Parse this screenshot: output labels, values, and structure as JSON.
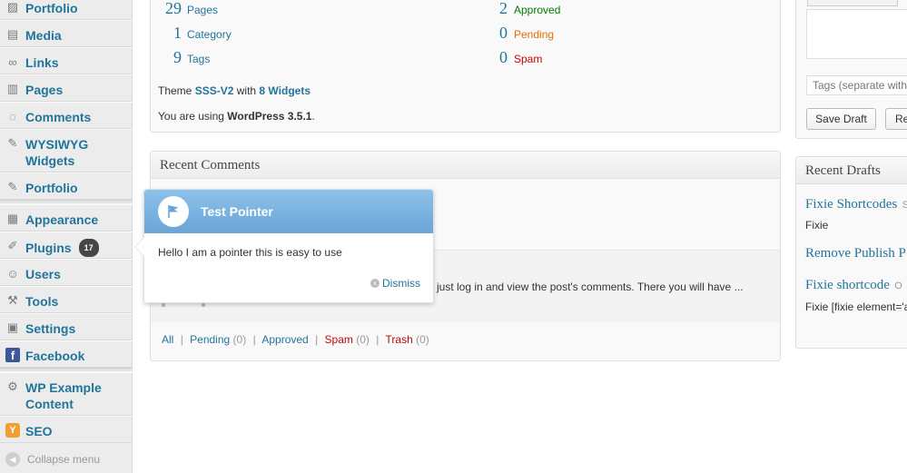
{
  "sidebar": {
    "items": [
      {
        "label": "Portfolio",
        "icon": "portfolio-icon",
        "glyph": "▨"
      },
      {
        "label": "Media",
        "icon": "media-icon",
        "glyph": "▤"
      },
      {
        "label": "Links",
        "icon": "link-icon",
        "glyph": "∞"
      },
      {
        "label": "Pages",
        "icon": "pages-icon",
        "glyph": "▥"
      },
      {
        "label": "Comments",
        "icon": "comments-icon",
        "glyph": "◌"
      },
      {
        "label": "WYSIWYG Widgets",
        "icon": "pin-icon",
        "glyph": "✎"
      },
      {
        "label": "Portfolio",
        "icon": "pin-icon",
        "glyph": "✎"
      },
      {
        "label": "Appearance",
        "icon": "appearance-icon",
        "glyph": "▦"
      },
      {
        "label": "Plugins",
        "icon": "plugins-icon",
        "glyph": "✐",
        "badge": "17"
      },
      {
        "label": "Users",
        "icon": "users-icon",
        "glyph": "☺"
      },
      {
        "label": "Tools",
        "icon": "tools-icon",
        "glyph": "⚒"
      },
      {
        "label": "Settings",
        "icon": "settings-icon",
        "glyph": "▣"
      },
      {
        "label": "Facebook",
        "icon": "facebook-icon",
        "glyph": "f"
      },
      {
        "label": "WP Example Content",
        "icon": "gear-icon",
        "glyph": "⚙"
      },
      {
        "label": "SEO",
        "icon": "seo-icon",
        "glyph": "Y"
      }
    ],
    "collapse_label": "Collapse menu"
  },
  "right_now": {
    "rows": [
      {
        "left_num": "29",
        "left_label": "Pages",
        "right_num": "2",
        "right_label": "Approved",
        "right_color": "#008000"
      },
      {
        "left_num": "1",
        "left_label": "Category",
        "right_num": "0",
        "right_label": "Pending",
        "right_color": "#e66f00"
      },
      {
        "left_num": "9",
        "left_label": "Tags",
        "right_num": "0",
        "right_label": "Spam",
        "right_color": "#cc0000"
      }
    ],
    "theme_prefix": "Theme",
    "theme_name": "SSS-V2",
    "theme_with": "with",
    "widgets_link": "8 Widgets",
    "wp_prefix": "You are using",
    "wp_version": "WordPress 3.5.1",
    "wp_suffix": "."
  },
  "recent_comments": {
    "title": "Recent Comments",
    "excerpt": "just log in and view the post's comments. There you will have ...",
    "filters": {
      "all": "All",
      "pending": "Pending",
      "pending_count": "(0)",
      "approved": "Approved",
      "spam": "Spam",
      "spam_count": "(0)",
      "trash": "Trash",
      "trash_count": "(0)",
      "sep": "|"
    }
  },
  "quick_press": {
    "tags_placeholder": "Tags (separate with",
    "save_draft": "Save Draft",
    "reset": "Re"
  },
  "recent_drafts": {
    "title": "Recent Drafts",
    "drafts": [
      {
        "title": "Fixie Shortcodes",
        "date": "S",
        "excerpt": "Fixie"
      },
      {
        "title": "Remove Publish P",
        "date": "",
        "excerpt": ""
      },
      {
        "title": "Fixie shortcode",
        "date": "O",
        "excerpt": "Fixie [fixie element='a"
      }
    ]
  },
  "pointer": {
    "title": "Test Pointer",
    "body": "Hello I am a pointer this is easy to use",
    "dismiss": "Dismiss"
  },
  "colors": {
    "link": "#21759b",
    "pointer_header": "#7ab3e0",
    "approved": "#008000",
    "pending": "#e66f00",
    "spam": "#cc0000"
  }
}
